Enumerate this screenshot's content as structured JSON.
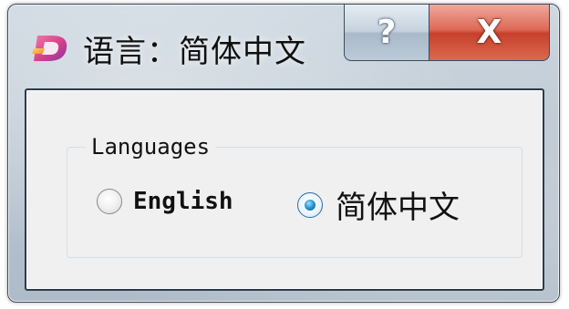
{
  "window": {
    "title": "语言：简体中文",
    "help_label": "?",
    "close_label": "X"
  },
  "group": {
    "legend": "Languages",
    "options": [
      {
        "label": "English",
        "checked": false
      },
      {
        "label": "简体中文",
        "checked": true
      }
    ]
  },
  "colors": {
    "close_button": "#c8402c",
    "radio_selected": "#2d9ad6",
    "client_background": "#f0f0f0"
  },
  "icons": {
    "app": "app-logo-icon",
    "help": "question-mark-icon",
    "close": "close-icon"
  }
}
